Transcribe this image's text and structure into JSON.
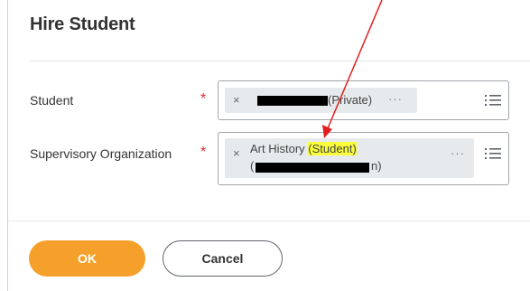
{
  "dialog": {
    "title": "Hire Student"
  },
  "fields": {
    "student": {
      "label": "Student",
      "required_mark": "*",
      "remove_glyph": "×",
      "value_suffix": "(Private)",
      "more_glyph": "···"
    },
    "supervisory_org": {
      "label": "Supervisory Organization",
      "required_mark": "*",
      "remove_glyph": "×",
      "value_prefix": "Art History ",
      "value_highlight": "(Student)",
      "value_line2_open": "(",
      "value_line2_close": "n)",
      "more_glyph": "···"
    }
  },
  "buttons": {
    "ok_label": "OK",
    "cancel_label": "Cancel"
  },
  "colors": {
    "accent": "#f5a02a",
    "required": "#de2a2a",
    "highlight": "#fbff3a",
    "annotation_arrow": "#e0201f"
  },
  "icons": {
    "prompt": "list-icon",
    "remove": "close-icon",
    "more": "ellipsis-icon"
  }
}
